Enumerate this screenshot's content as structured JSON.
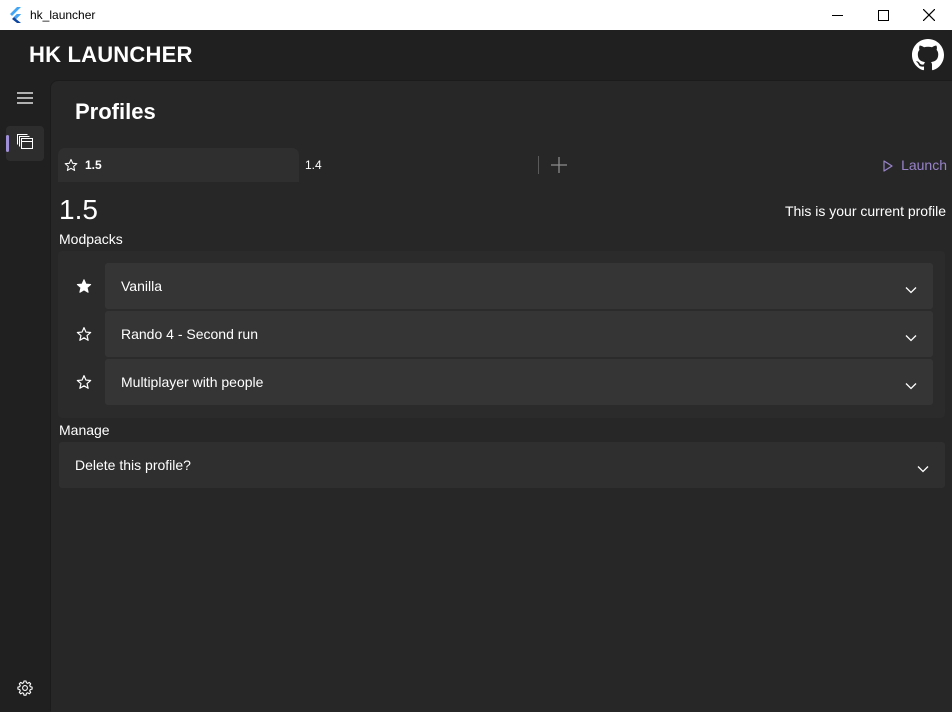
{
  "window": {
    "title": "hk_launcher"
  },
  "header": {
    "title": "HK LAUNCHER"
  },
  "page": {
    "title": "Profiles"
  },
  "tabs": [
    {
      "label": "1.5",
      "active": true,
      "starred": false
    },
    {
      "label": "1.4",
      "active": false
    }
  ],
  "launch": {
    "label": "Launch"
  },
  "profile": {
    "name": "1.5",
    "current_note": "This is your current profile",
    "modpacks_label": "Modpacks",
    "modpacks": [
      {
        "name": "Vanilla",
        "starred": true
      },
      {
        "name": "Rando 4 - Second run",
        "starred": false
      },
      {
        "name": "Multiplayer with people",
        "starred": false
      }
    ],
    "manage_label": "Manage",
    "delete_label": "Delete this profile?"
  },
  "colors": {
    "accent": "#9883c9",
    "background": "#202020",
    "content_background": "#272727"
  },
  "icons": {
    "app": "flutter-icon",
    "github": "github-icon",
    "menu": "hamburger-icon",
    "profiles": "profiles-icon",
    "settings": "gear-icon"
  }
}
